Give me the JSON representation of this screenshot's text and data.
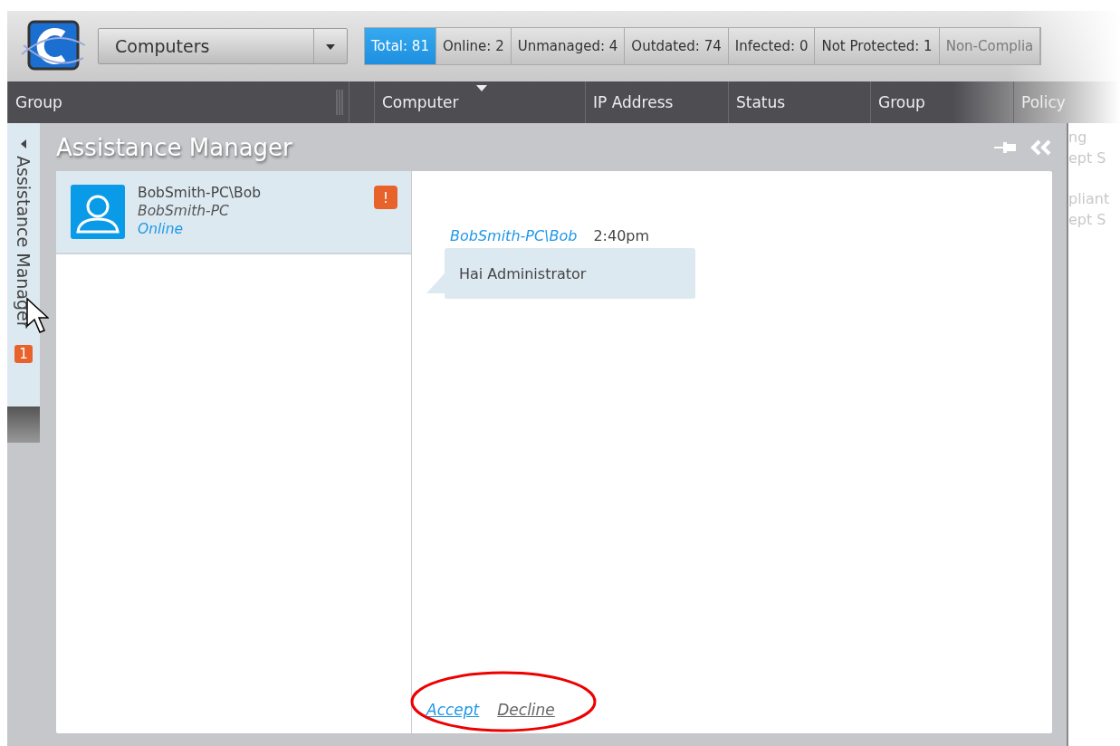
{
  "view_selector": {
    "value": "Computers"
  },
  "summary_tabs": [
    {
      "label": "Total: 81",
      "selected": true
    },
    {
      "label": "Online: 2",
      "selected": false
    },
    {
      "label": "Unmanaged: 4",
      "selected": false
    },
    {
      "label": "Outdated: 74",
      "selected": false
    },
    {
      "label": "Infected: 0",
      "selected": false
    },
    {
      "label": "Not Protected: 1",
      "selected": false
    },
    {
      "label": "Non-Complia",
      "selected": false
    }
  ],
  "columns": [
    {
      "label": "Group",
      "sorted": false
    },
    {
      "label": "Computer",
      "sorted": true
    },
    {
      "label": "IP Address",
      "sorted": false
    },
    {
      "label": "Status",
      "sorted": false
    },
    {
      "label": "Group",
      "sorted": false
    },
    {
      "label": "Policy",
      "sorted": false
    }
  ],
  "side_tab": {
    "label": "Assistance Manager",
    "badge": "1"
  },
  "panel": {
    "title": "Assistance Manager",
    "contacts": [
      {
        "name": "BobSmith-PC\\Bob",
        "computer": "BobSmith-PC",
        "status": "Online",
        "alert": "!",
        "selected": true
      }
    ],
    "messages": [
      {
        "sender": "BobSmith-PC\\Bob",
        "time": "2:40pm",
        "text": "Hai Administrator"
      }
    ],
    "actions": [
      {
        "label": "Accept",
        "kind": "primary"
      },
      {
        "label": "Decline",
        "kind": "secondary"
      }
    ]
  },
  "background_fragments": [
    "ng",
    "ept S",
    "pliant",
    "ept S"
  ]
}
